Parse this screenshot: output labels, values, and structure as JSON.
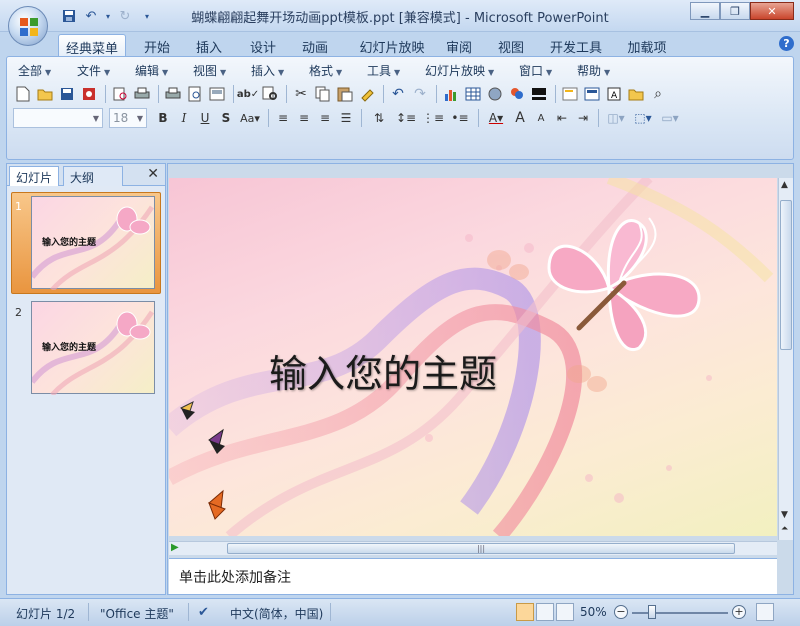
{
  "window": {
    "title": "蝴蝶翩翩起舞开场动画ppt模板.ppt [兼容模式] - Microsoft PowerPoint"
  },
  "ribbon_tabs": [
    "经典菜单",
    "开始",
    "插入",
    "设计",
    "动画",
    "幻灯片放映",
    "审阅",
    "视图",
    "开发工具",
    "加载项"
  ],
  "menu_bar": [
    "全部",
    "文件",
    "编辑",
    "视图",
    "插入",
    "格式",
    "工具",
    "幻灯片放映",
    "窗口",
    "帮助"
  ],
  "format_bar": {
    "font_size": "18"
  },
  "panel": {
    "tab_slides": "幻灯片",
    "tab_outline": "大纲"
  },
  "thumbnails": [
    {
      "num": "1",
      "title": "输入您的主题"
    },
    {
      "num": "2",
      "title": "输入您的主题"
    }
  ],
  "slide": {
    "title": "输入您的主题"
  },
  "notes": {
    "placeholder": "单击此处添加备注"
  },
  "status": {
    "slide_info": "幻灯片 1/2",
    "theme": "\"Office 主题\"",
    "language": "中文(简体，中国)",
    "zoom": "50%"
  },
  "colors": {
    "accent": "#2b5797",
    "selection": "#f8c78a"
  }
}
